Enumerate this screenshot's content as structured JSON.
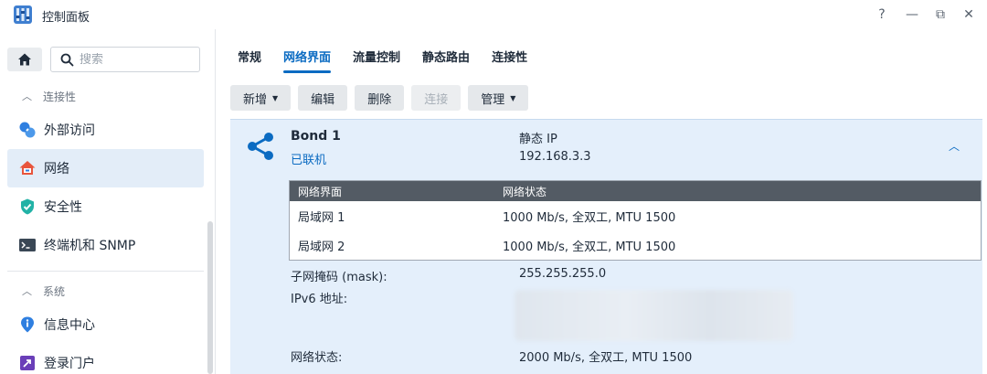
{
  "window": {
    "title": "控制面板",
    "help": "?",
    "minimize": "—",
    "restore": "⧉",
    "close": "✕"
  },
  "sidebar": {
    "search_placeholder": "搜索",
    "sections": [
      {
        "label": "连接性",
        "items": [
          {
            "label": "外部访问",
            "icon": "external-access-icon"
          },
          {
            "label": "网络",
            "icon": "network-home-icon",
            "active": true
          },
          {
            "label": "安全性",
            "icon": "shield-icon"
          },
          {
            "label": "终端机和 SNMP",
            "icon": "terminal-icon"
          }
        ]
      },
      {
        "label": "系统",
        "items": [
          {
            "label": "信息中心",
            "icon": "info-icon"
          },
          {
            "label": "登录门户",
            "icon": "login-portal-icon"
          }
        ]
      }
    ]
  },
  "tabs": [
    "常规",
    "网络界面",
    "流量控制",
    "静态路由",
    "连接性"
  ],
  "active_tab": "网络界面",
  "toolbar": {
    "create": "新增",
    "edit": "编辑",
    "delete": "删除",
    "connect": "连接",
    "manage": "管理"
  },
  "bond": {
    "name": "Bond 1",
    "status": "已联机",
    "ip_type": "静态 IP",
    "ip": "192.168.3.3",
    "collapse_icon": "chevron-up-icon",
    "table": {
      "headers": [
        "网络界面",
        "网络状态"
      ],
      "rows": [
        [
          "局域网 1",
          "1000 Mb/s, 全双工, MTU 1500"
        ],
        [
          "局域网 2",
          "1000 Mb/s, 全双工, MTU 1500"
        ]
      ]
    },
    "mask_label": "子网掩码 (mask):",
    "mask": "255.255.255.0",
    "ipv6_label": "IPv6 地址:",
    "net_status_label": "网络状态:",
    "net_status": "2000 Mb/s, 全双工, MTU 1500"
  },
  "colors": {
    "accent": "#0b6bc2",
    "panel_bg": "#e4effb",
    "table_header": "#535b64"
  }
}
